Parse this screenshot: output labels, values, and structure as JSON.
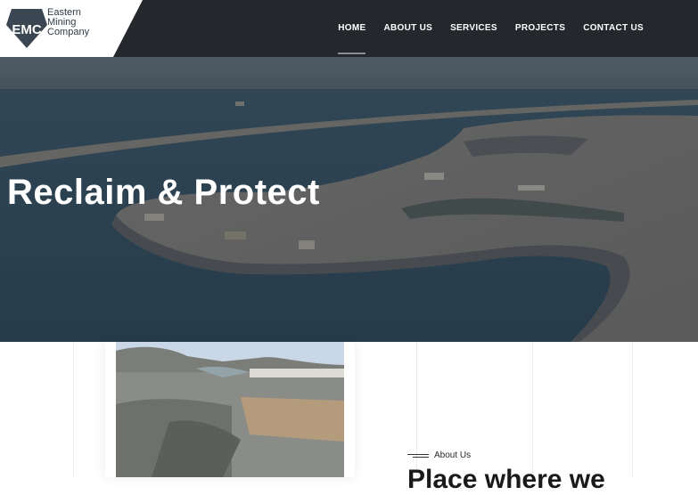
{
  "brand": {
    "logo_mark": "EMC",
    "logo_lines": [
      "Eastern",
      "Mining",
      "Company"
    ],
    "logo_icon": "shield-logo-icon"
  },
  "nav": {
    "items": [
      {
        "label": "HOME",
        "active": true
      },
      {
        "label": "ABOUT US",
        "active": false
      },
      {
        "label": "SERVICES",
        "active": false
      },
      {
        "label": "PROJECTS",
        "active": false
      },
      {
        "label": "CONTACT US",
        "active": false
      }
    ]
  },
  "hero": {
    "title": "Reclaim & Protect"
  },
  "about": {
    "label": "About Us",
    "heading": "Place where we"
  },
  "colors": {
    "header_bg": "#24272b",
    "logo_shield": "#3a4651",
    "text_dark": "#1a1a1a"
  }
}
